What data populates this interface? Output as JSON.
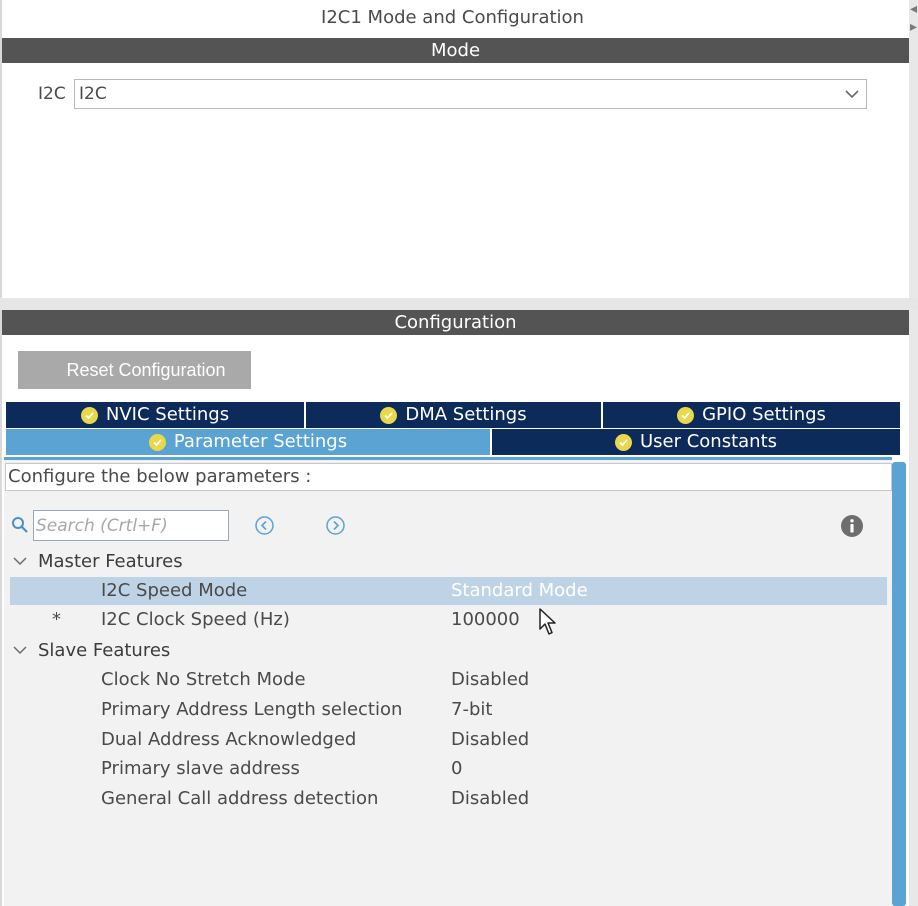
{
  "window": {
    "title": "I2C1 Mode and Configuration"
  },
  "mode": {
    "section_label": "Mode",
    "i2c_label": "I2C",
    "i2c_value": "I2C"
  },
  "configuration": {
    "section_label": "Configuration",
    "reset_button": "Reset Configuration",
    "tabs": [
      {
        "label": "NVIC Settings",
        "active": false
      },
      {
        "label": "DMA Settings",
        "active": false
      },
      {
        "label": "GPIO Settings",
        "active": false
      },
      {
        "label": "Parameter Settings",
        "active": true
      },
      {
        "label": "User Constants",
        "active": false
      }
    ],
    "instructions": "Configure the below parameters :",
    "search_placeholder": "Search (Crtl+F)",
    "groups": [
      {
        "label": "Master Features",
        "params": [
          {
            "name": "I2C Speed Mode",
            "value": "Standard Mode",
            "selected": true,
            "marker": ""
          },
          {
            "name": "I2C Clock Speed (Hz)",
            "value": "100000",
            "selected": false,
            "marker": "*"
          }
        ]
      },
      {
        "label": "Slave Features",
        "params": [
          {
            "name": "Clock No Stretch Mode",
            "value": "Disabled",
            "selected": false,
            "marker": ""
          },
          {
            "name": "Primary Address Length selection",
            "value": "7-bit",
            "selected": false,
            "marker": ""
          },
          {
            "name": "Dual Address Acknowledged",
            "value": "Disabled",
            "selected": false,
            "marker": ""
          },
          {
            "name": "Primary slave address",
            "value": "0",
            "selected": false,
            "marker": ""
          },
          {
            "name": "General Call address detection",
            "value": "Disabled",
            "selected": false,
            "marker": ""
          }
        ]
      }
    ]
  },
  "colors": {
    "section_bar": "#545454",
    "tab_dark": "#0c2a5a",
    "tab_active": "#5aa3d3",
    "check_badge": "#e8d84a",
    "selected_row": "#bfd3e6"
  },
  "icons": [
    "chevron-down-icon",
    "check-icon",
    "search-icon",
    "prev-arrow-icon",
    "next-arrow-icon",
    "info-icon",
    "mouse-cursor-icon"
  ]
}
